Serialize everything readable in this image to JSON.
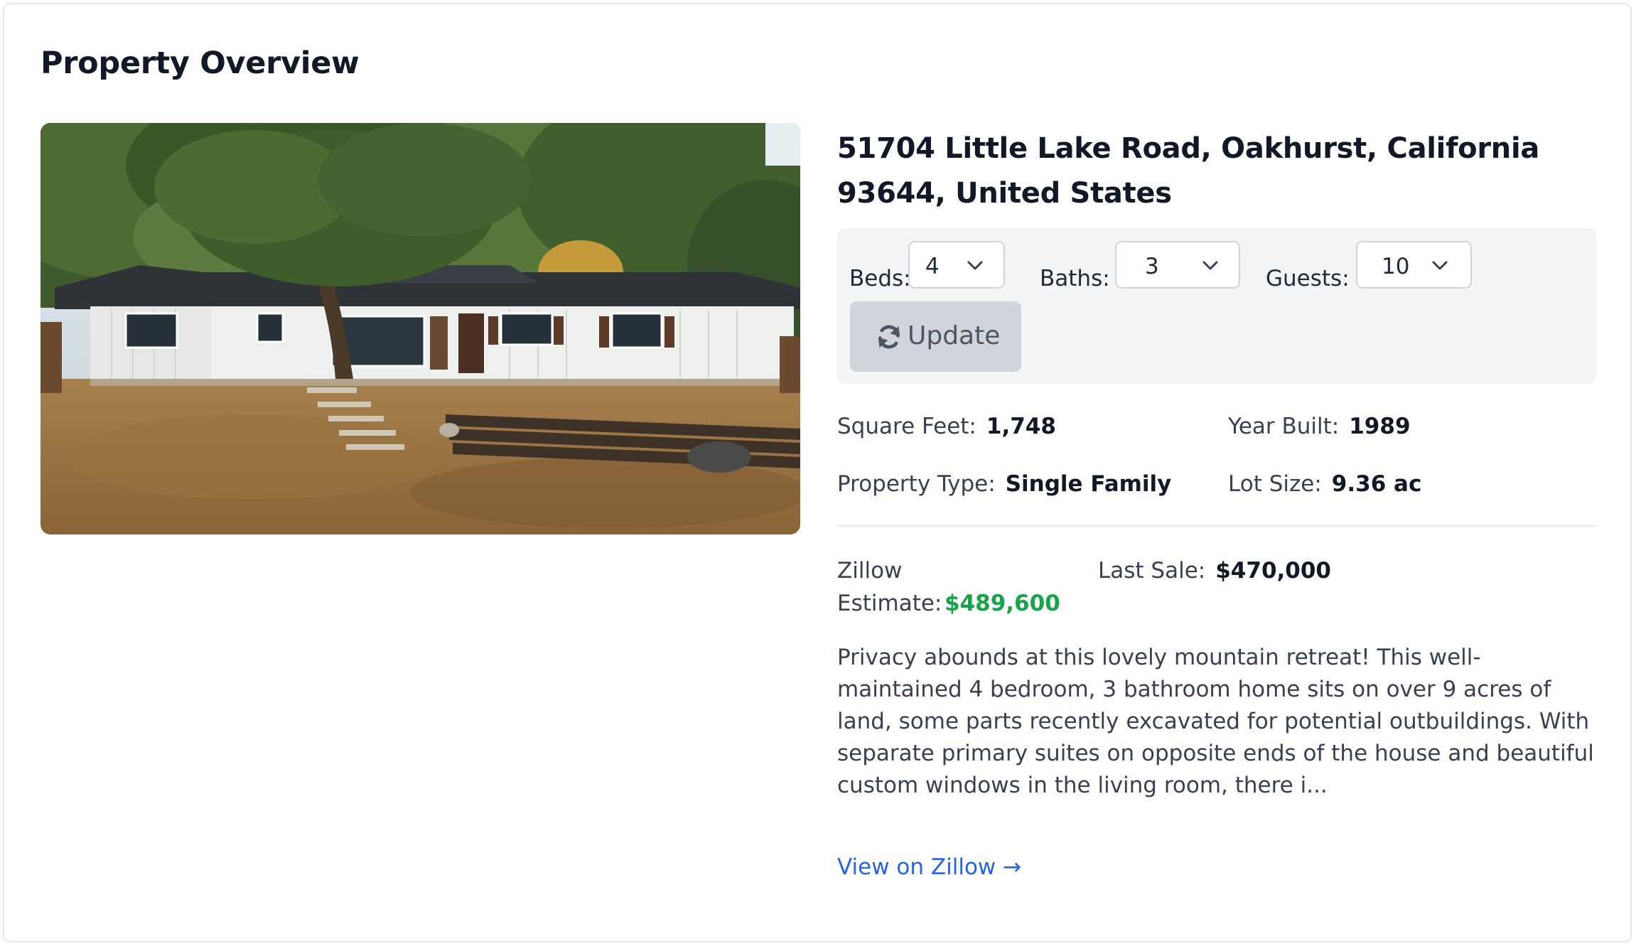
{
  "page_title": "Property Overview",
  "photo": {
    "alt": "house-photo"
  },
  "address": "51704 Little Lake Road, Oakhurst, California 93644, United States",
  "filters": {
    "beds_label": "Beds:",
    "beds_value": "4",
    "baths_label": "Baths:",
    "baths_value": "3",
    "guests_label": "Guests:",
    "guests_value": "10",
    "update_label": "Update"
  },
  "facts": {
    "square_feet_label": "Square Feet:",
    "square_feet_value": "1,748",
    "year_built_label": "Year Built:",
    "year_built_value": "1989",
    "property_type_label": "Property Type:",
    "property_type_value": "Single Family",
    "lot_size_label": "Lot Size:",
    "lot_size_value": "9.36 ac"
  },
  "valuation": {
    "zillow_label_line1": "Zillow",
    "zillow_label_line2": "Estimate:",
    "zillow_value": "$489,600",
    "last_sale_label": "Last Sale:",
    "last_sale_value": "$470,000"
  },
  "description": "Privacy abounds at this lovely mountain retreat! This well-maintained 4 bedroom, 3 bathroom home sits on over 9 acres of land, some parts recently excavated for potential outbuildings. With separate primary suites on opposite ends of the house and beautiful custom windows in the living room, there i...",
  "zillow_link": "View on Zillow →",
  "colors": {
    "estimate_green": "#16a34a",
    "link_blue": "#2563eb",
    "panel_bg": "#f3f4f6",
    "button_bg": "#d1d5db"
  },
  "icons": [
    "chevron-down-icon",
    "refresh-icon",
    "arrow-right-icon"
  ]
}
